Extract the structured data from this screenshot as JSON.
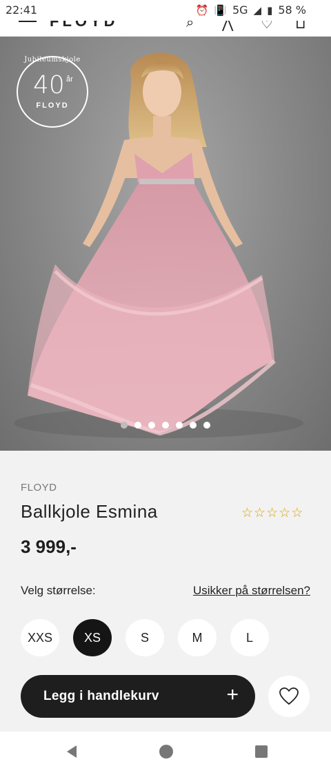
{
  "status_bar": {
    "time": "22:41",
    "network": "5G",
    "battery": "58 %",
    "icons": [
      "alarm-icon",
      "vibrate-icon",
      "signal-icon",
      "battery-icon"
    ]
  },
  "header": {
    "logo_text": "FLOYD",
    "icons": [
      "menu-icon",
      "search-icon",
      "account-icon",
      "favorite-icon",
      "bag-icon"
    ]
  },
  "hero": {
    "badge": {
      "arc_text": "Jubileumskjole",
      "number": "40",
      "suffix": "år",
      "brand": "FLOYD"
    },
    "image_count": 7,
    "active_image": 1
  },
  "product": {
    "brand": "FLOYD",
    "name": "Ballkjole Esmina",
    "rating": 0,
    "rating_max": 5,
    "price": "3 999,-"
  },
  "sizes": {
    "label": "Velg størrelse:",
    "help_link": "Usikker på størrelsen?",
    "options": [
      "XXS",
      "XS",
      "S",
      "M",
      "L"
    ],
    "selected": "XS"
  },
  "actions": {
    "add_to_cart": "Legg i handlekurv",
    "add_icon": "+"
  },
  "colors": {
    "dress": "#e8b4bc",
    "dark_button": "#1e1e1e",
    "star": "#d9a300"
  },
  "nav": [
    "back-icon",
    "home-icon",
    "recents-icon"
  ]
}
